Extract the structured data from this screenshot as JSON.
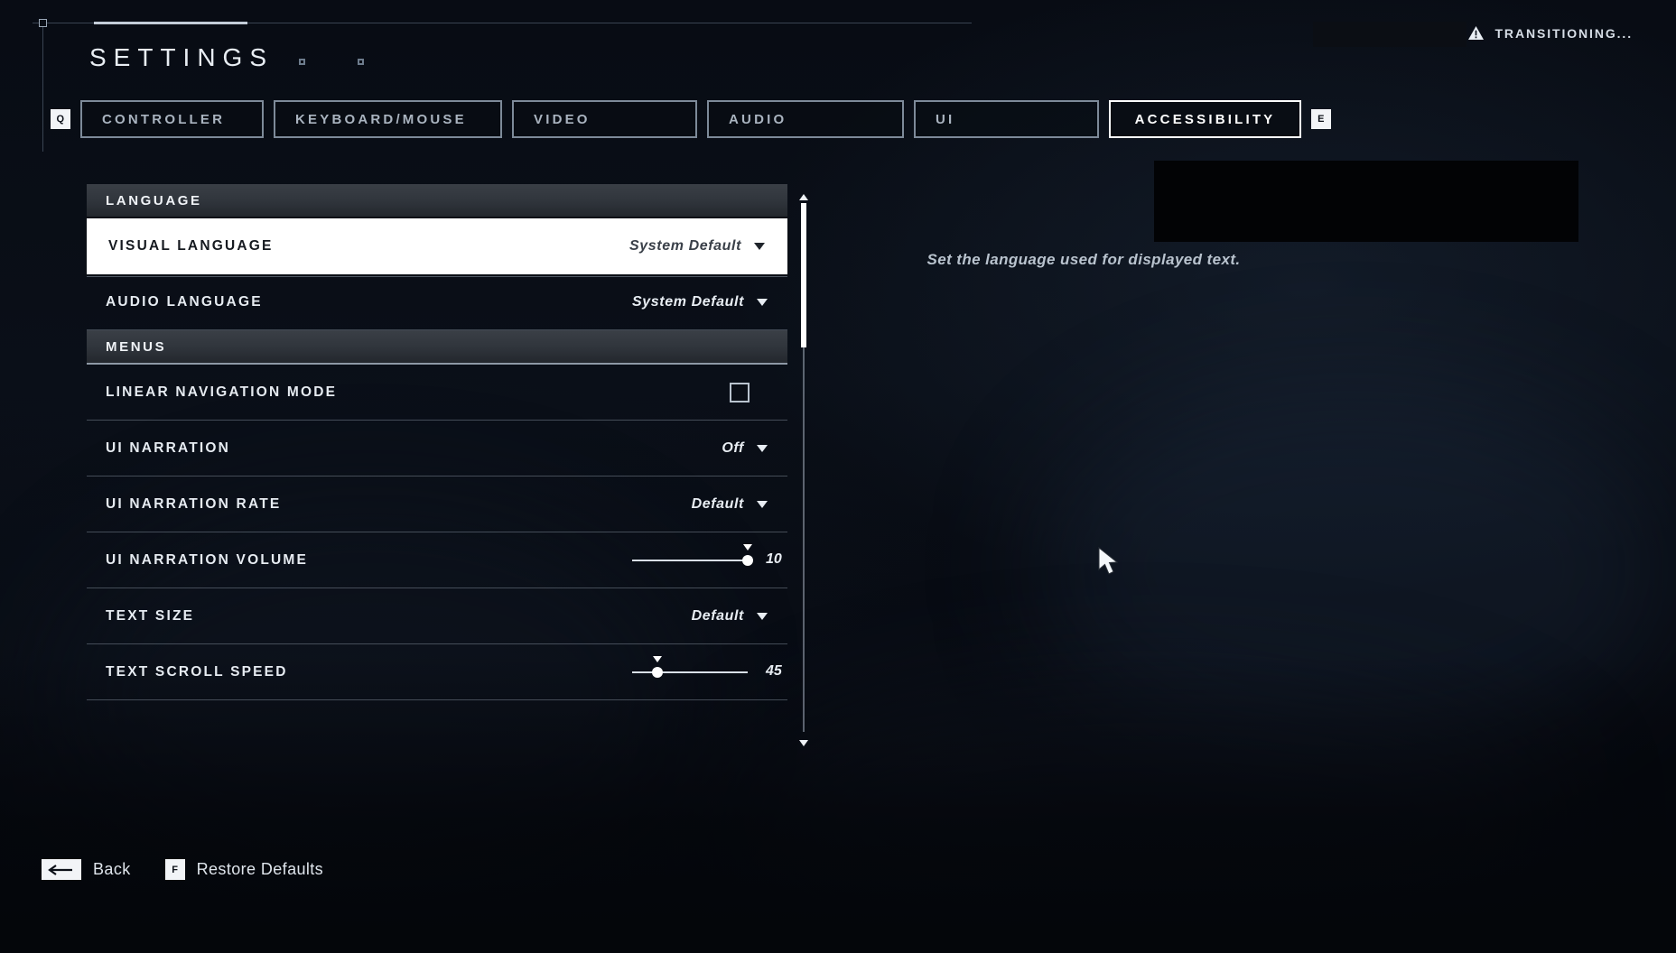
{
  "status": {
    "icon": "warning-triangle-icon",
    "text": "TRANSITIONING..."
  },
  "header": {
    "title": "SETTINGS",
    "prev_key": "Q",
    "next_key": "E"
  },
  "tabs": [
    {
      "label": "CONTROLLER",
      "active": false
    },
    {
      "label": "KEYBOARD/MOUSE",
      "active": false
    },
    {
      "label": "VIDEO",
      "active": false
    },
    {
      "label": "AUDIO",
      "active": false
    },
    {
      "label": "UI",
      "active": false
    },
    {
      "label": "ACCESSIBILITY",
      "active": true
    }
  ],
  "sections": [
    {
      "title": "LANGUAGE"
    },
    {
      "title": "MENUS"
    }
  ],
  "rows": {
    "visual_language": {
      "label": "VISUAL LANGUAGE",
      "value": "System Default",
      "control": "dropdown",
      "selected": true
    },
    "audio_language": {
      "label": "AUDIO LANGUAGE",
      "value": "System Default",
      "control": "dropdown"
    },
    "linear_navigation": {
      "label": "LINEAR NAVIGATION MODE",
      "control": "checkbox",
      "checked": false
    },
    "ui_narration": {
      "label": "UI NARRATION",
      "value": "Off",
      "control": "dropdown"
    },
    "ui_narration_rate": {
      "label": "UI NARRATION RATE",
      "value": "Default",
      "control": "dropdown"
    },
    "ui_narration_volume": {
      "label": "UI NARRATION VOLUME",
      "value": "10",
      "control": "slider",
      "percent": 100
    },
    "text_size": {
      "label": "TEXT SIZE",
      "value": "Default",
      "control": "dropdown"
    },
    "text_scroll_speed": {
      "label": "TEXT SCROLL SPEED",
      "value": "45",
      "control": "slider",
      "percent": 22
    }
  },
  "description": {
    "text": "Set the language used for displayed text."
  },
  "footer": {
    "back": {
      "key_icon": "backspace-arrow-icon",
      "label": "Back"
    },
    "restore": {
      "key": "F",
      "label": "Restore Defaults"
    }
  },
  "colors": {
    "accent_white": "#ffffff",
    "text_primary": "#e8edf3",
    "text_muted": "#aab4c0",
    "border": "#7d8a99",
    "background": "#05070c"
  }
}
